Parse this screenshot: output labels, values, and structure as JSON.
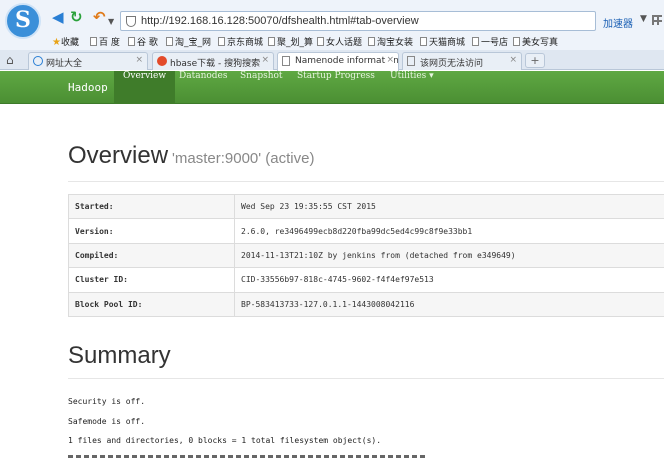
{
  "browser": {
    "url": "http://192.168.16.128:50070/dfshealth.html#tab-overview",
    "accelerator_label": "加速器",
    "bookmarks": [
      "收藏",
      "百 度",
      "谷 歌",
      "淘_宝_网",
      "京东商城",
      "聚_划_算",
      "女人话题",
      "淘宝女装",
      "天猫商城",
      "一号店",
      "美女写真"
    ],
    "tabs": [
      {
        "label": "网址大全"
      },
      {
        "label": "hbase下载 - 搜狗搜索"
      },
      {
        "label": "Namenode information"
      },
      {
        "label": "该网页无法访问"
      }
    ],
    "new_tab": "+"
  },
  "hadoop_nav": {
    "brand": "Hadoop",
    "items": [
      "Overview",
      "Datanodes",
      "Snapshot",
      "Startup Progress",
      "Utilities ▾"
    ]
  },
  "overview": {
    "heading": "Overview",
    "subtitle": "'master:9000' (active)",
    "rows": [
      {
        "key": "Started:",
        "value": "Wed Sep 23 19:35:55 CST 2015"
      },
      {
        "key": "Version:",
        "value": "2.6.0, re3496499ecb8d220fba99dc5ed4c99c8f9e33bb1"
      },
      {
        "key": "Compiled:",
        "value": "2014-11-13T21:10Z by jenkins from (detached from e349649)"
      },
      {
        "key": "Cluster ID:",
        "value": "CID-33556b97-818c-4745-9602-f4f4ef97e513"
      },
      {
        "key": "Block Pool ID:",
        "value": "BP-583413733-127.0.1.1-1443008042116"
      }
    ]
  },
  "summary": {
    "heading": "Summary",
    "lines": [
      "Security is off.",
      "Safemode is off.",
      "1 files and directories, 0 blocks = 1 total filesystem object(s)."
    ]
  },
  "colors": {
    "navbar_green": "#5fa843",
    "navbar_active": "#3f7c2a",
    "link_blue": "#1a5fb4"
  }
}
